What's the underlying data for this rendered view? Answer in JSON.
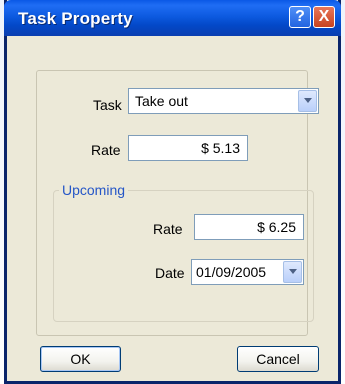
{
  "window": {
    "title": "Task Property"
  },
  "titlebar_buttons": {
    "help": "?",
    "close": "X"
  },
  "form": {
    "task_label": "Task",
    "task_value": "Take out",
    "rate_label": "Rate",
    "rate_value": "$ 5.13"
  },
  "upcoming": {
    "group_label": "Upcoming",
    "rate_label": "Rate",
    "rate_value": "$ 6.25",
    "date_label": "Date",
    "date_value": "01/09/2005"
  },
  "buttons": {
    "ok": "OK",
    "cancel": "Cancel"
  },
  "colors": {
    "titlebar": "#0a58e6",
    "dialog_bg": "#ece9d8",
    "group_label": "#2556c7"
  },
  "icons": {
    "dropdown": "chevron-down-icon",
    "help": "help-icon",
    "close": "close-icon"
  }
}
